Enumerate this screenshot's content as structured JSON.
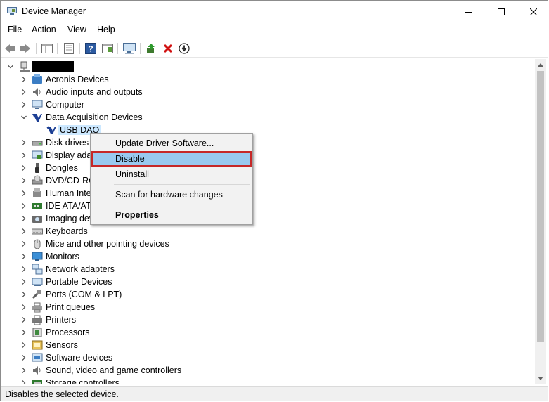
{
  "window": {
    "title": "Device Manager"
  },
  "menu": [
    "File",
    "Action",
    "View",
    "Help"
  ],
  "tree": {
    "root_label": "",
    "items": [
      {
        "label": "Acronis Devices",
        "icon": "acronis-icon",
        "expanded": false
      },
      {
        "label": "Audio inputs and outputs",
        "icon": "speaker-icon",
        "expanded": false
      },
      {
        "label": "Computer",
        "icon": "computer-icon",
        "expanded": false
      },
      {
        "label": "Data Acquisition Devices",
        "icon": "daq-icon",
        "expanded": true
      },
      {
        "label": "USB DAQ",
        "icon": "daq-icon",
        "child": true,
        "selected": true
      },
      {
        "label": "Disk drives",
        "icon": "disk-drive-icon",
        "expanded": false
      },
      {
        "label": "Display adap",
        "icon": "display-adapter-icon",
        "expanded": false
      },
      {
        "label": "Dongles",
        "icon": "dongle-icon",
        "expanded": false
      },
      {
        "label": "DVD/CD-RC",
        "icon": "dvd-icon",
        "expanded": false
      },
      {
        "label": "Human Inte",
        "icon": "hid-icon",
        "expanded": false
      },
      {
        "label": "IDE ATA/ATA",
        "icon": "ide-icon",
        "expanded": false
      },
      {
        "label": "Imaging dev",
        "icon": "camera-icon",
        "expanded": false
      },
      {
        "label": "Keyboards",
        "icon": "keyboard-icon",
        "expanded": false
      },
      {
        "label": "Mice and other pointing devices",
        "icon": "mouse-icon",
        "expanded": false
      },
      {
        "label": "Monitors",
        "icon": "monitor-icon",
        "expanded": false
      },
      {
        "label": "Network adapters",
        "icon": "network-icon",
        "expanded": false
      },
      {
        "label": "Portable Devices",
        "icon": "portable-device-icon",
        "expanded": false
      },
      {
        "label": "Ports (COM & LPT)",
        "icon": "port-icon",
        "expanded": false
      },
      {
        "label": "Print queues",
        "icon": "print-queue-icon",
        "expanded": false
      },
      {
        "label": "Printers",
        "icon": "printer-icon",
        "expanded": false
      },
      {
        "label": "Processors",
        "icon": "processor-icon",
        "expanded": false
      },
      {
        "label": "Sensors",
        "icon": "sensor-icon",
        "expanded": false
      },
      {
        "label": "Software devices",
        "icon": "software-device-icon",
        "expanded": false
      },
      {
        "label": "Sound, video and game controllers",
        "icon": "sound-icon",
        "expanded": false
      },
      {
        "label": "Storage controllers",
        "icon": "storage-icon",
        "expanded": false
      }
    ]
  },
  "context_menu": {
    "items": [
      {
        "label": "Update Driver Software...",
        "bold": false,
        "highlighted": false
      },
      {
        "label": "Disable",
        "bold": false,
        "highlighted": true
      },
      {
        "label": "Uninstall",
        "bold": false,
        "highlighted": false
      },
      {
        "label": "Scan for hardware changes",
        "bold": false,
        "highlighted": false
      },
      {
        "label": "Properties",
        "bold": true,
        "highlighted": false
      }
    ]
  },
  "status": {
    "text": "Disables the selected device."
  },
  "colors": {
    "selection": "#cce8ff",
    "menu_highlight": "#99c9ef",
    "highlight_border": "#c62828",
    "toolbar_red": "#d01010",
    "daq_blue": "#1c3f94"
  }
}
